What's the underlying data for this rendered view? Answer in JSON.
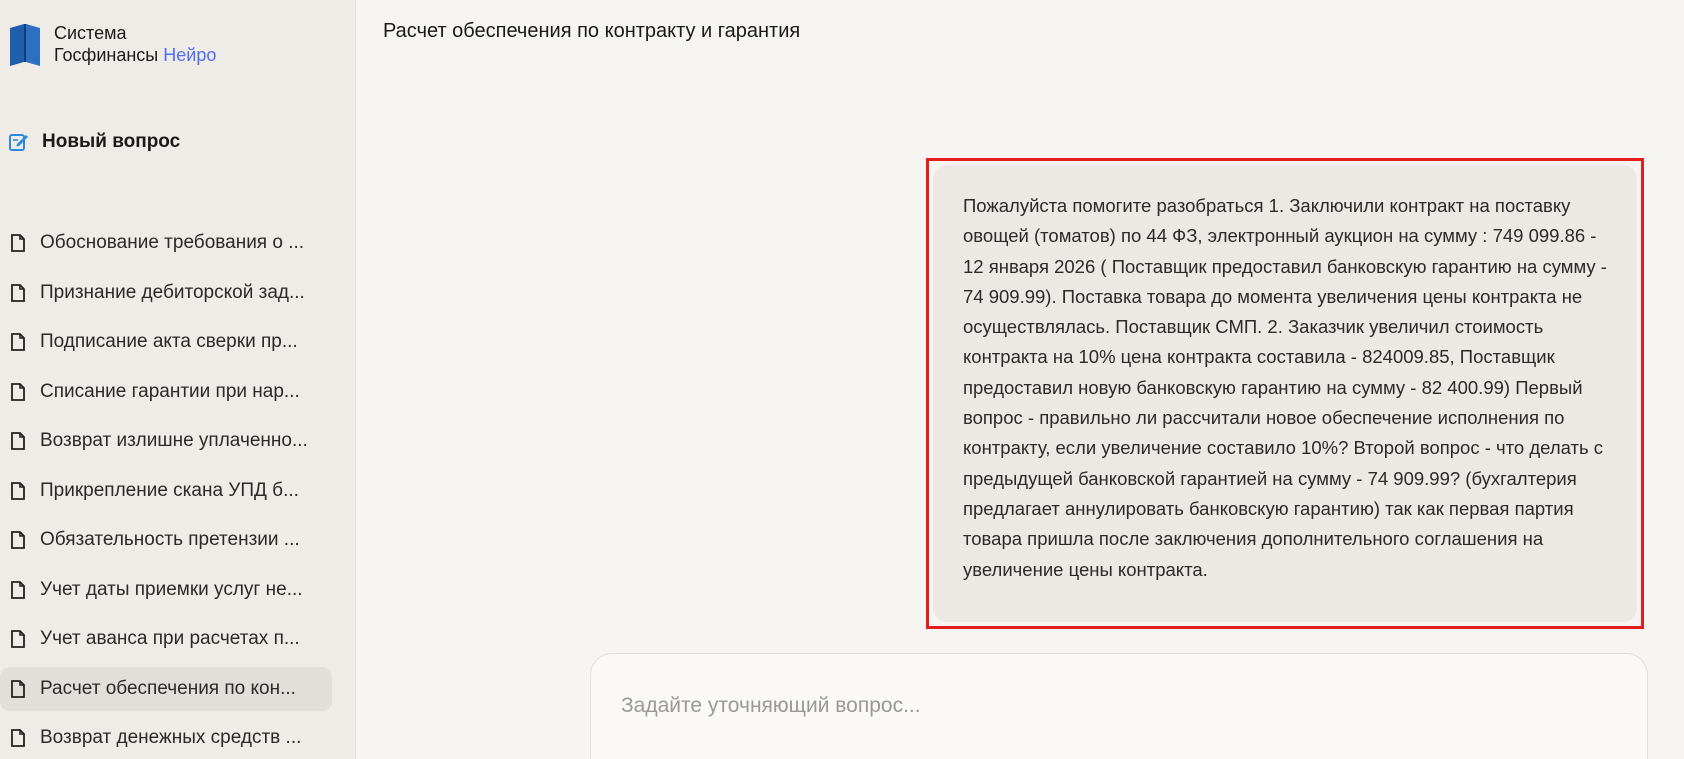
{
  "sidebar": {
    "logo": {
      "line1": "Система",
      "line2": "Госфинансы",
      "accent": "Нейро"
    },
    "new_question": "Новый вопрос",
    "history": [
      {
        "label": "Обоснование требования о ..."
      },
      {
        "label": "Признание дебиторской зад..."
      },
      {
        "label": "Подписание акта сверки пр..."
      },
      {
        "label": "Списание гарантии при нар..."
      },
      {
        "label": "Возврат излишне уплаченно..."
      },
      {
        "label": "Прикрепление скана УПД б..."
      },
      {
        "label": "Обязательность претензии ..."
      },
      {
        "label": "Учет даты приемки услуг не..."
      },
      {
        "label": "Учет аванса при расчетах п..."
      },
      {
        "label": "Расчет обеспечения по кон...",
        "active": true
      },
      {
        "label": "Возврат денежных средств ..."
      }
    ]
  },
  "main": {
    "title": "Расчет обеспечения по контракту и гарантия",
    "user_message": "Пожалуйста помогите разобраться 1. Заключили контракт на поставку овощей (томатов) по 44 ФЗ, электронный аукцион на сумму : 749 099.86 - 12 января 2026 ( Поставщик предоставил банковскую гарантию на сумму - 74 909.99). Поставка товара до момента увеличения цены контракта не осуществлялась. Поставщик СМП. 2. Заказчик увеличил стоимость контракта на 10% цена контракта составила - 824009.85, Поставщик предоставил новую банковскую гарантию на сумму - 82 400.99) Первый вопрос - правильно ли рассчитали новое обеспечение исполнения по контракту, если увеличение составило 10%? Второй вопрос - что делать с предыдущей банковской гарантией на сумму - 74 909.99? (бухгалтерия предлагает аннулировать банковскую гарантию) так как первая партия товара пришла после заключения дополнительного соглашения на увеличение цены контракта.",
    "input": {
      "placeholder": "Задайте уточняющий вопрос...",
      "value": ""
    }
  },
  "colors": {
    "accent": "#4f6ef7",
    "highlight_border": "#e41e1e",
    "logo_blue": "#1f5fae"
  }
}
